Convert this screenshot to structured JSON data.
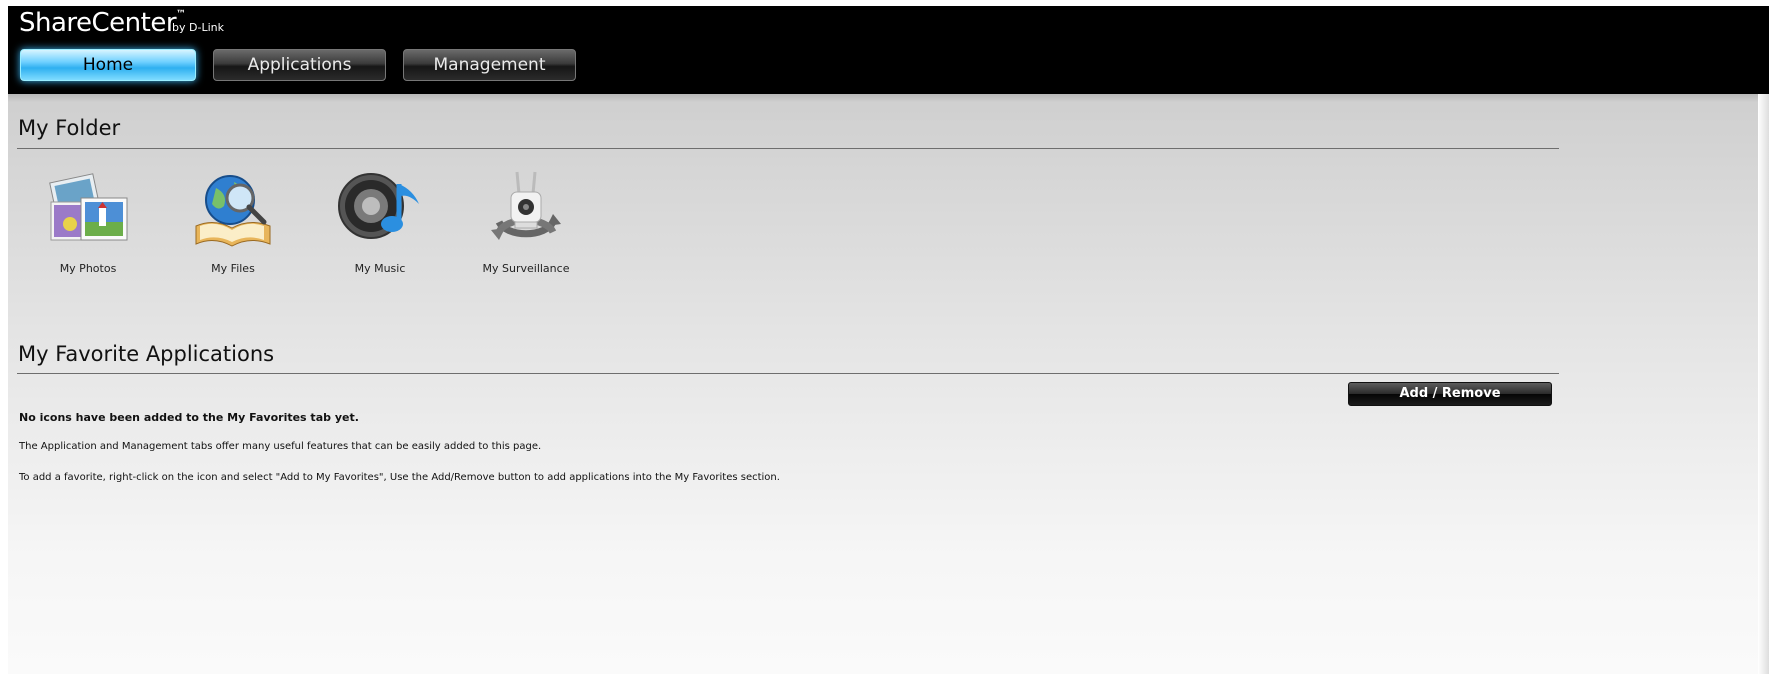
{
  "header": {
    "brand": "ShareCenter",
    "trademark": "™",
    "byline": "by D-Link",
    "tabs": [
      {
        "label": "Home",
        "active": true
      },
      {
        "label": "Applications",
        "active": false
      },
      {
        "label": "Management",
        "active": false
      }
    ]
  },
  "my_folder": {
    "title": "My Folder",
    "items": [
      {
        "label": "My Photos",
        "icon": "photos-icon"
      },
      {
        "label": "My Files",
        "icon": "files-icon"
      },
      {
        "label": "My Music",
        "icon": "music-icon"
      },
      {
        "label": "My Surveillance",
        "icon": "surveillance-camera-icon"
      }
    ]
  },
  "favorites": {
    "title": "My Favorite Applications",
    "add_remove_label": "Add / Remove",
    "empty_heading": "No icons have been added to the My Favorites tab yet.",
    "line1": "The Application and Management tabs offer many useful features that can be easily added to this page.",
    "line2": "To add a favorite, right-click on the icon and select \"Add to My Favorites\", Use the Add/Remove button to add applications into the My Favorites section."
  },
  "colors": {
    "header_bg": "#000000",
    "active_tab": "#2fb0f0"
  }
}
